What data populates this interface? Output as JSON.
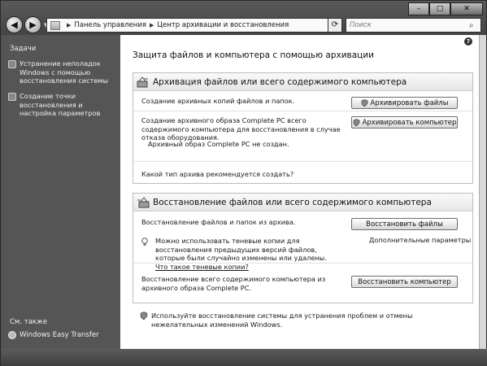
{
  "window": {
    "controls": [
      "–",
      "□",
      "✕"
    ]
  },
  "address": {
    "crumbs": [
      "Панель управления",
      "Центр архивации и восстановления"
    ]
  },
  "search": {
    "placeholder": "Поиск"
  },
  "leftpane": {
    "tasks_header": "Задачи",
    "tasks": [
      "Устранение неполадок Windows с помощью восстановления системы",
      "Создание точки восстановления и настройка параметров"
    ],
    "see_also": "См. также",
    "transfer": "Windows Easy Transfer"
  },
  "main": {
    "title": "Защита файлов и компьютера с помощью архивации",
    "backup": {
      "heading": "Архивация файлов или всего содержимого компьютера",
      "files_text": "Создание архивных копий файлов и папок.",
      "files_button": "Архивировать файлы",
      "pc_text": "Создание архивного образа Complete PC всего содержимого компьютера для восстановления в случае отказа оборудования.",
      "pc_button": "Архивировать компьютер",
      "pc_status": "Архивный образ Complete PC не создан.",
      "link": "Какой тип архива рекомендуется создать?"
    },
    "restore": {
      "heading": "Восстановление файлов или всего содержимого компьютера",
      "files_text": "Восстановление файлов и папок из архива.",
      "files_button": "Восстановить файлы",
      "advanced_link": "Дополнительные параметры",
      "shadow_text": "Можно использовать теневые копии для восстановления предыдущих версий файлов, которые были случайно изменены или удалены.",
      "shadow_link": "Что такое теневые копии?",
      "pc_text": "Восстановление всего содержимого компьютера из архивного образа Complete PC.",
      "pc_button": "Восстановить компьютер"
    },
    "footer_text": "Используйте восстановление системы для устранения проблем и отмены нежелательных изменений Windows."
  }
}
